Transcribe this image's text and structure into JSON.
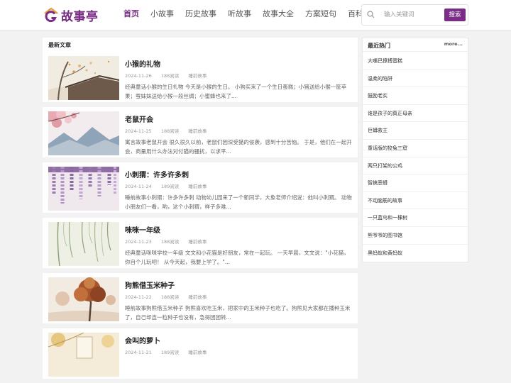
{
  "brand": {
    "name": "故事亭",
    "accent": "#7a2d86"
  },
  "nav": [
    {
      "label": "首页",
      "active": true
    },
    {
      "label": "小故事"
    },
    {
      "label": "历史故事"
    },
    {
      "label": "听故事"
    },
    {
      "label": "故事大全"
    },
    {
      "label": "方案短句"
    },
    {
      "label": "百科问答"
    }
  ],
  "search": {
    "placeholder": "输入关键词",
    "value": "",
    "button": "搜索",
    "icon": "search-icon"
  },
  "main": {
    "title": "最新文章",
    "articles": [
      {
        "title": "小猴的礼物",
        "date": "2024-11-26",
        "views": "188阅读",
        "category": "睡前故事",
        "desc": "经典童话小猴的生日礼物 今天是小猴的生日。 小狗买来了一个生日蛋糕；小猪送给小猴一筐苹果；蚕妹妹送给小猴一段丝绸；小蜜蜂也来了..."
      },
      {
        "title": "老鼠开会",
        "date": "2024-11-25",
        "views": "188阅读",
        "category": "睡前故事",
        "desc": "寓言故事老鼠开会 很久很久以前，老鼠们因深受猫的侵袭，感到十分苦恼。 于是，他们在一起开会，商量用什么办法对付猫的骚扰，以求平..."
      },
      {
        "title": "小刺猬：许多许多刺",
        "date": "2024-11-24",
        "views": "189阅读",
        "category": "睡前故事",
        "desc": "睡前故事小刺猬：许多许多刺 动物幼儿园来了一个新同学，大象老师介绍说：他叫小刺猬。 动物小朋友们一看，哟，这个小刺猬，样子多难..."
      },
      {
        "title": "咪咪一年级",
        "date": "2024-11-23",
        "views": "188阅读",
        "category": "睡前故事",
        "desc": "经典童话咪咪学校一年级 文文和小花猫是好朋友，常在一起玩。 一天早晨，文文说：\"小花猫，你自个儿玩吧！ 从今天起，我要上学了。\"..."
      },
      {
        "title": "狗熊借玉米种子",
        "date": "2024-11-22",
        "views": "188阅读",
        "category": "睡前故事",
        "desc": "睡前故事狗熊借玉米种子 狗熊喜欢吃玉米，把家中的玉米种子也吃了。狗熊见大家都在播种玉米了，自己却连一粒种子也没有，急得团团转..."
      },
      {
        "title": "会叫的萝卜",
        "date": "2024-11-21",
        "views": "189阅读",
        "category": "睡前故事",
        "desc": ""
      }
    ]
  },
  "sidebar": {
    "title": "最近热门",
    "more": "more...",
    "items": [
      "大嘴巴撩搏蛋糕",
      "温柔的陷阱",
      "鼓励老实",
      "谁是孩子的真正母亲",
      "巨蟒救主",
      "童话版的狡兔三窟",
      "两只打架的公鸡",
      "智擒恶蟒",
      "不动脑筋的故事",
      "一只蓝鸟和一棵树",
      "熊爷爷的图书馆",
      "黑蚂蚁和黄蚂蚁"
    ]
  }
}
